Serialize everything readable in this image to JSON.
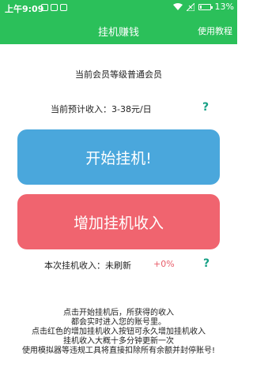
{
  "status_bar": {
    "time": "上午9:09",
    "battery": "13%"
  },
  "app_bar": {
    "title": "挂机赚钱",
    "help_link": "使用教程"
  },
  "member_level": "当前会员等级普通会员",
  "estimated_income": "当前预计收入：3-38元/日",
  "buttons": {
    "start": "开始挂机!",
    "add_income": "增加挂机收入"
  },
  "this_session": {
    "label": "本次挂机收入：未刷新",
    "percent": "+0%"
  },
  "help_symbol": "?",
  "description": [
    "点击开始挂机后，所获得的收入",
    "都会实时进入您的账号里。",
    "点击红色的增加挂机收入按钮可永久增加挂机收入",
    "挂机收入大概十多分钟更新一次",
    "使用模拟器等违规工具将直接扣除所有余额并封停账号!"
  ],
  "colors": {
    "primary_green": "#2bc05a",
    "start_blue": "#4aa7dc",
    "add_red": "#f0646f",
    "help_teal": "#16a085"
  },
  "icons": [
    "wifi-icon",
    "signal-icon",
    "battery-icon"
  ]
}
